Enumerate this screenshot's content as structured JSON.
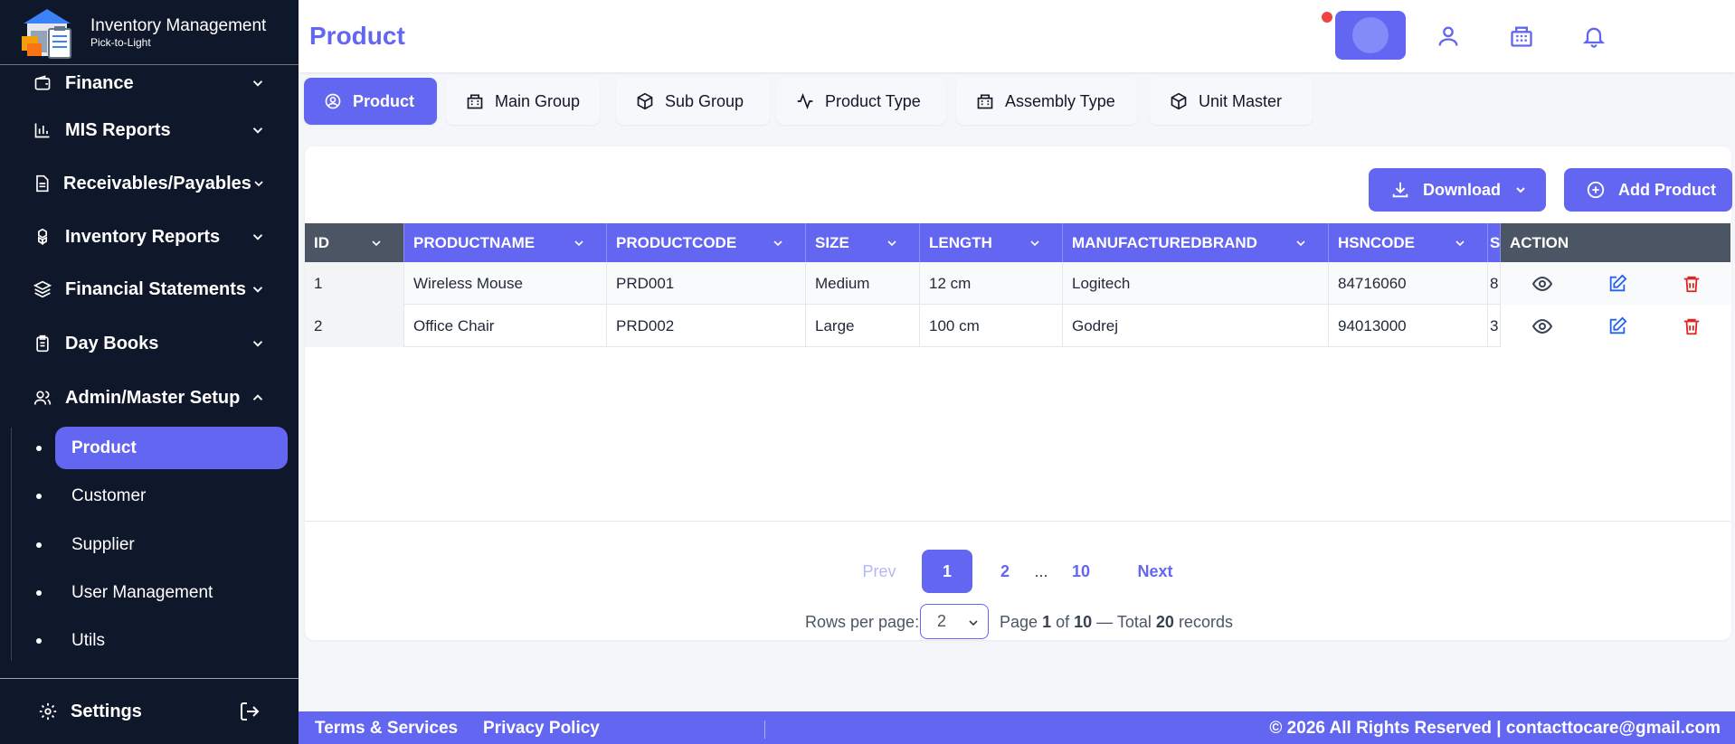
{
  "brand": {
    "title": "Inventory Management",
    "subtitle": "Pick-to-Light"
  },
  "sidebar": {
    "items": [
      {
        "label": "Finance",
        "icon": "wallet-icon"
      },
      {
        "label": "MIS Reports",
        "icon": "bar-chart-icon"
      },
      {
        "label": "Receivables/Payables",
        "icon": "document-icon"
      },
      {
        "label": "Inventory Reports",
        "icon": "boxes-icon"
      },
      {
        "label": "Financial Statements",
        "icon": "layers-icon"
      },
      {
        "label": "Day Books",
        "icon": "clipboard-icon"
      },
      {
        "label": "Admin/Master Setup",
        "icon": "users-icon",
        "expanded": true
      }
    ],
    "sub_items": [
      "Product",
      "Customer",
      "Supplier",
      "User Management",
      "Utils"
    ],
    "active_sub": "Product",
    "settings_label": "Settings"
  },
  "header": {
    "title": "Product"
  },
  "tabs": [
    "Product",
    "Main Group",
    "Sub Group",
    "Product Type",
    "Assembly Type",
    "Unit Master"
  ],
  "toolbar": {
    "download_label": "Download",
    "add_label": "Add Product"
  },
  "table": {
    "columns": [
      "ID",
      "PRODUCTNAME",
      "PRODUCTCODE",
      "SIZE",
      "LENGTH",
      "MANUFACTUREDBRAND",
      "HSNCODE",
      "S",
      "ACTION"
    ],
    "rows": [
      [
        "1",
        "Wireless Mouse",
        "PRD001",
        "Medium",
        "12 cm",
        "Logitech",
        "84716060",
        "8"
      ],
      [
        "2",
        "Office Chair",
        "PRD002",
        "Large",
        "100 cm",
        "Godrej",
        "94013000",
        "3"
      ]
    ]
  },
  "pagination": {
    "prev": "Prev",
    "next": "Next",
    "pages": [
      "1",
      "2",
      "...",
      "10"
    ],
    "rows_label": "Rows per page:",
    "rows_value": "2",
    "page_word": "Page",
    "current": "1",
    "of_word": "of",
    "total_pages": "10",
    "total_word": "— Total",
    "total_records": "20",
    "records_word": "records"
  },
  "footer": {
    "terms": "Terms & Services",
    "privacy": "Privacy Policy",
    "copyright": "© 2026 All Rights Reserved | contacttocare@gmail.com"
  },
  "colors": {
    "accent": "#6366f1",
    "sidebar": "#0f172a",
    "danger": "#dc2626",
    "edit": "#2563eb"
  }
}
